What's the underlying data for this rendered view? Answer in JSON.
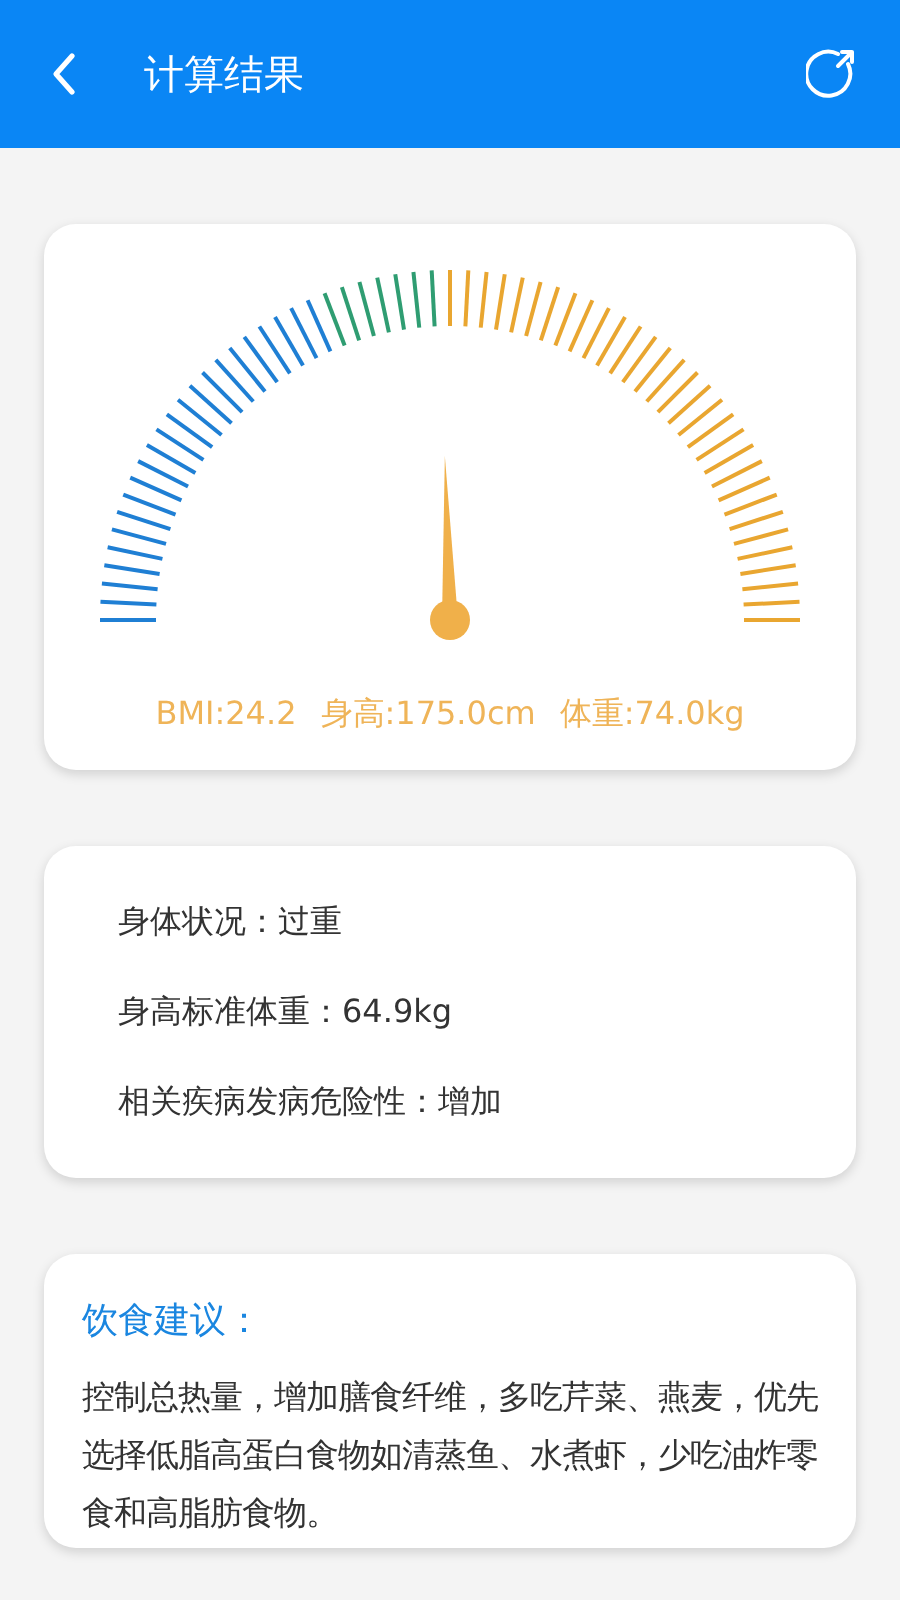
{
  "header": {
    "title": "计算结果"
  },
  "gauge": {
    "readings": [
      "BMI:24.2",
      "身高:175.0cm",
      "体重:74.0kg"
    ]
  },
  "status": [
    "身体状况：过重",
    "身高标准体重：64.9kg",
    "相关疾病发病危险性：增加"
  ],
  "advice": {
    "title": "饮食建议：",
    "text": "控制总热量，增加膳食纤维，多吃芹菜、燕麦，优先选择低脂高蛋白食物如清蒸鱼、水煮虾，少吃油炸零食和高脂肪食物。"
  }
}
